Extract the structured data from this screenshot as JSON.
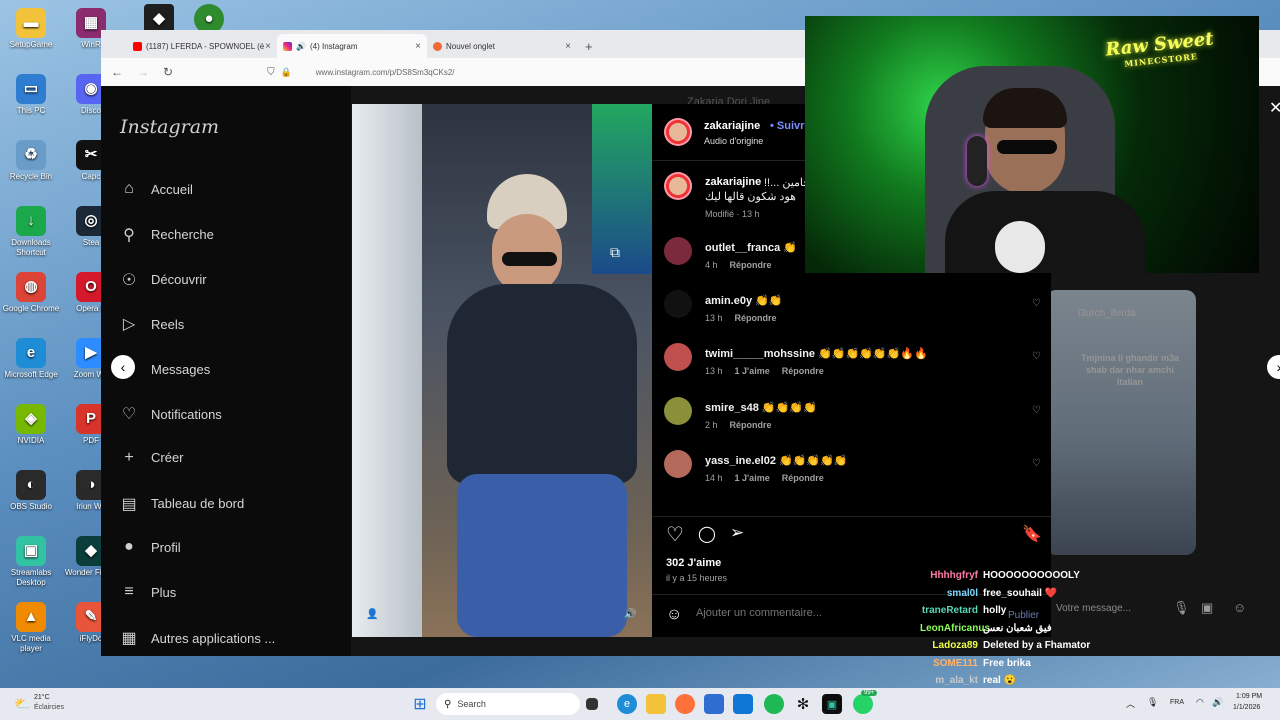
{
  "desktop": {
    "icons": [
      {
        "label": "SetupGame",
        "icon": "folder-icon",
        "color": "#f2c33a"
      },
      {
        "label": "WinR",
        "icon": "winrar-icon",
        "color": "#8a2c6e"
      },
      {
        "label": "This PC",
        "icon": "monitor-icon",
        "color": "#2f7dd1"
      },
      {
        "label": "Disco",
        "icon": "discord-icon",
        "color": "#5865f2"
      },
      {
        "label": "Recycle Bin",
        "icon": "recycle-bin-icon",
        "color": "#6a9cc9"
      },
      {
        "label": "Capc",
        "icon": "capcut-icon",
        "color": "#111111"
      },
      {
        "label": "Downloads Shortcut",
        "icon": "download-icon",
        "color": "#1aa84a"
      },
      {
        "label": "Stea",
        "icon": "steam-icon",
        "color": "#1b2838"
      },
      {
        "label": "Google Chrome",
        "icon": "chrome-icon",
        "color": "#db4437"
      },
      {
        "label": "Opera B",
        "icon": "opera-icon",
        "color": "#d3192b"
      },
      {
        "label": "Microsoft Edge",
        "icon": "edge-icon",
        "color": "#1f8cd6"
      },
      {
        "label": "Zoom Wo",
        "icon": "zoom-icon",
        "color": "#2d8cff"
      },
      {
        "label": "NVIDIA",
        "icon": "nvidia-icon",
        "color": "#76b900"
      },
      {
        "label": "PDF",
        "icon": "pdf-icon",
        "color": "#d9342b"
      },
      {
        "label": "OBS Studio",
        "icon": "obs-icon",
        "color": "#2a2a2a"
      },
      {
        "label": "Iriun We",
        "icon": "iriun-icon",
        "color": "#2a2a2a"
      },
      {
        "label": "Streamlabs Desktop",
        "icon": "streamlabs-icon",
        "color": "#31c3a2"
      },
      {
        "label": "Wonder Filmor",
        "icon": "filmora-icon",
        "color": "#0b3d3a"
      },
      {
        "label": "VLC media player",
        "icon": "vlc-icon",
        "color": "#f08a00"
      },
      {
        "label": "iFlyDo",
        "icon": "ifly-icon",
        "color": "#e8553a"
      }
    ],
    "top_icons": [
      {
        "icon": "roblox-icon",
        "color": "#1e1e1e"
      },
      {
        "icon": "game-ball-icon",
        "color": "#2e8b2e"
      }
    ]
  },
  "browser": {
    "tabs": [
      {
        "label": "(1187) LFERDA - SPOWNOEL (é",
        "icon": "youtube-icon",
        "color": "#ff0000",
        "active": false
      },
      {
        "label": "(4) Instagram",
        "icon": "instagram-icon",
        "color": "#d62976",
        "active": true
      },
      {
        "label": "Nouvel onglet",
        "icon": "new-tab-icon",
        "color": "#f06a35",
        "active": false
      }
    ],
    "url": "www.instagram.com/p/DS8Sm3qCKs2/"
  },
  "instagram": {
    "logo": "Instagram",
    "nav": [
      {
        "label": "Accueil",
        "icon": "home-icon",
        "glyph": "⌂"
      },
      {
        "label": "Recherche",
        "icon": "search-icon",
        "glyph": "⚲"
      },
      {
        "label": "Découvrir",
        "icon": "explore-icon",
        "glyph": "☉"
      },
      {
        "label": "Reels",
        "icon": "reels-icon",
        "glyph": "▷"
      },
      {
        "label": "Messages",
        "icon": "messages-icon",
        "glyph": "✈"
      },
      {
        "label": "Notifications",
        "icon": "heart-icon",
        "glyph": "♡"
      },
      {
        "label": "Créer",
        "icon": "plus-icon",
        "glyph": "+"
      },
      {
        "label": "Tableau de bord",
        "icon": "dashboard-icon",
        "glyph": "▤"
      },
      {
        "label": "Profil",
        "icon": "profile-icon",
        "glyph": "●"
      },
      {
        "label": "Plus",
        "icon": "menu-icon",
        "glyph": "≡"
      },
      {
        "label": "Autres applications ...",
        "icon": "apps-icon",
        "glyph": "▦"
      }
    ],
    "background_profile": {
      "name": "Zakaria Dori Jine"
    },
    "post": {
      "author": "zakariajine",
      "follow_label": "Suivre",
      "audio": "Audio d'origine",
      "caption_user": "zakariajine",
      "caption_line1": "!!... حامين",
      "caption_line2": "هود شكون قالها ليك",
      "caption_meta": "Modifié · 13 h",
      "comments": [
        {
          "user": "outlet__franca",
          "text": "👏",
          "time": "4 h",
          "likes": "",
          "reply": "Répondre",
          "avatar": "#7a2a3a"
        },
        {
          "user": "amin.e0y",
          "text": "👏👏",
          "time": "13 h",
          "likes": "",
          "reply": "Répondre",
          "avatar": "#111111"
        },
        {
          "user": "twimi_____mohssine",
          "text": "👏👏👏👏👏👏🔥🔥",
          "time": "13 h",
          "likes": "1 J'aime",
          "reply": "Répondre",
          "avatar": "#c0504d"
        },
        {
          "user": "smire_s48",
          "text": "👏👏👏👏",
          "time": "2 h",
          "likes": "",
          "reply": "Répondre",
          "avatar": "#8a8f3a"
        },
        {
          "user": "yass_ine.el02",
          "text": "👏👏👏👏👏",
          "time": "14 h",
          "likes": "1 J'aime",
          "reply": "Répondre",
          "avatar": "#b46a5a"
        }
      ],
      "like_count": "302 J'aime",
      "posted_ago": "il y a 15 heures",
      "comment_placeholder": "Ajouter un commentaire...",
      "publish_label": "Publier"
    },
    "right_story": {
      "user": "l3urch_lferda",
      "caption": "Tmjnina li ghandir m3a shab dar nhar amchi Itallan",
      "message_placeholder": "Votre message..."
    }
  },
  "stream_chat": [
    {
      "user": "Hhhhgfryf",
      "color": "#ff7aa6",
      "msg": "HOOOOOOOOOOLY"
    },
    {
      "user": "smal0l",
      "color": "#7ad9ff",
      "msg": "free_souhail ❤️"
    },
    {
      "user": "traneRetard",
      "color": "#5ad7b8",
      "msg": "holly"
    },
    {
      "user": "LeonAfricanus",
      "color": "#8cff5a",
      "msg": "فيق شعبان نعس"
    },
    {
      "user": "Ladoza89",
      "color": "#f2ff4a",
      "msg": "Deleted by a Fhamator"
    },
    {
      "user": "SOME111",
      "color": "#ffb26b",
      "msg": "Free brika"
    },
    {
      "user": "m_ala_kt",
      "color": "#c9c9c9",
      "msg": "real 😮"
    }
  ],
  "webcam": {
    "neon_sign_line1": "Raw Sweet",
    "neon_sign_line2": "MINECSTORE"
  },
  "taskbar": {
    "weather_temp": "21°C",
    "weather_desc": "Éclaircies",
    "search_placeholder": "Search",
    "language": "FRA",
    "time": "1:09 PM",
    "date": "1/1/2026",
    "whatsapp_badge": "99+"
  }
}
